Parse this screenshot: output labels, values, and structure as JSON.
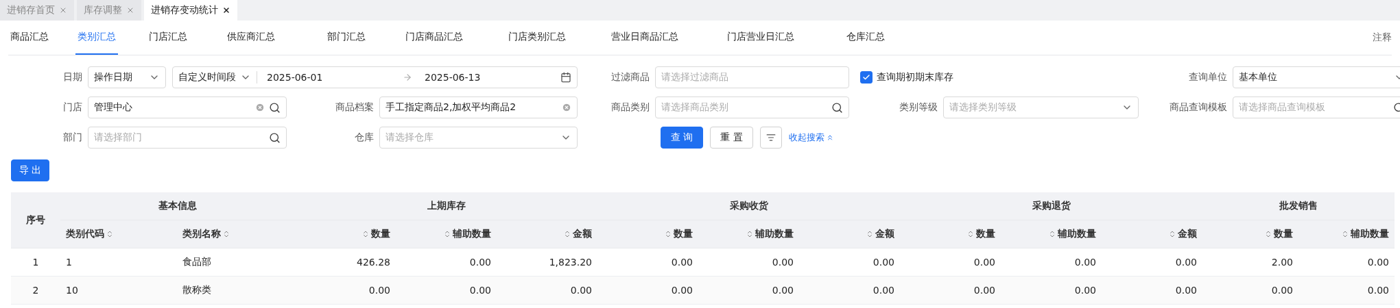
{
  "open_tabs": [
    {
      "label": "进销存首页",
      "selected": false
    },
    {
      "label": "库存调整",
      "selected": false
    },
    {
      "label": "进销存变动统计",
      "selected": true
    }
  ],
  "report_tabs": [
    {
      "label": "商品汇总",
      "selected": false
    },
    {
      "label": "类别汇总",
      "selected": true
    },
    {
      "label": "门店汇总",
      "selected": false
    },
    {
      "label": "供应商汇总",
      "selected": false
    },
    {
      "label": "部门汇总",
      "selected": false
    },
    {
      "label": "门店商品汇总",
      "selected": false
    },
    {
      "label": "门店类别汇总",
      "selected": false
    },
    {
      "label": "营业日商品汇总",
      "selected": false
    },
    {
      "label": "门店营业日汇总",
      "selected": false
    },
    {
      "label": "仓库汇总",
      "selected": false
    }
  ],
  "annotation_link": "注释",
  "filters": {
    "date": {
      "label": "日期",
      "type_value": "操作日期",
      "range_mode": "自定义时间段",
      "start": "2025-06-01",
      "end": "2025-06-13"
    },
    "filter_goods": {
      "label": "过滤商品",
      "placeholder": "请选择过滤商品"
    },
    "opening_closing_stock": {
      "label": "查询期初期末库存",
      "checked": true
    },
    "query_unit": {
      "label": "查询单位",
      "value": "基本单位"
    },
    "store": {
      "label": "门店",
      "value": "管理中心"
    },
    "goods_file": {
      "label": "商品档案",
      "value": "手工指定商品2,加权平均商品2"
    },
    "goods_category": {
      "label": "商品类别",
      "placeholder": "请选择商品类别"
    },
    "category_level": {
      "label": "类别等级",
      "placeholder": "请选择类别等级"
    },
    "goods_template": {
      "label": "商品查询模板",
      "placeholder": "请选择商品查询模板"
    },
    "department": {
      "label": "部门",
      "placeholder": "请选择部门"
    },
    "warehouse": {
      "label": "仓库",
      "placeholder": "请选择仓库"
    }
  },
  "actions": {
    "query": "查 询",
    "reset": "重 置",
    "collapse": "收起搜索"
  },
  "export": "导 出",
  "table": {
    "index_header": "序号",
    "groups": [
      {
        "title": "基本信息",
        "kind": "text",
        "columns": [
          "类别代码",
          "类别名称"
        ]
      },
      {
        "title": "上期库存",
        "kind": "number",
        "columns": [
          "数量",
          "辅助数量",
          "金额"
        ]
      },
      {
        "title": "采购收货",
        "kind": "number",
        "columns": [
          "数量",
          "辅助数量",
          "金额"
        ]
      },
      {
        "title": "采购退货",
        "kind": "number",
        "columns": [
          "数量",
          "辅助数量",
          "金额"
        ]
      },
      {
        "title": "批发销售",
        "kind": "number",
        "columns": [
          "数量",
          "辅助数量"
        ]
      }
    ],
    "rows": [
      {
        "index": "1",
        "cells": [
          "1",
          "食品部",
          "426.28",
          "0.00",
          "1,823.20",
          "0.00",
          "0.00",
          "0.00",
          "0.00",
          "0.00",
          "0.00",
          "2.00",
          "0.00"
        ]
      },
      {
        "index": "2",
        "cells": [
          "10",
          "散称类",
          "0.00",
          "0.00",
          "0.00",
          "0.00",
          "0.00",
          "0.00",
          "0.00",
          "0.00",
          "0.00",
          "0.00",
          "0.00"
        ]
      }
    ]
  }
}
